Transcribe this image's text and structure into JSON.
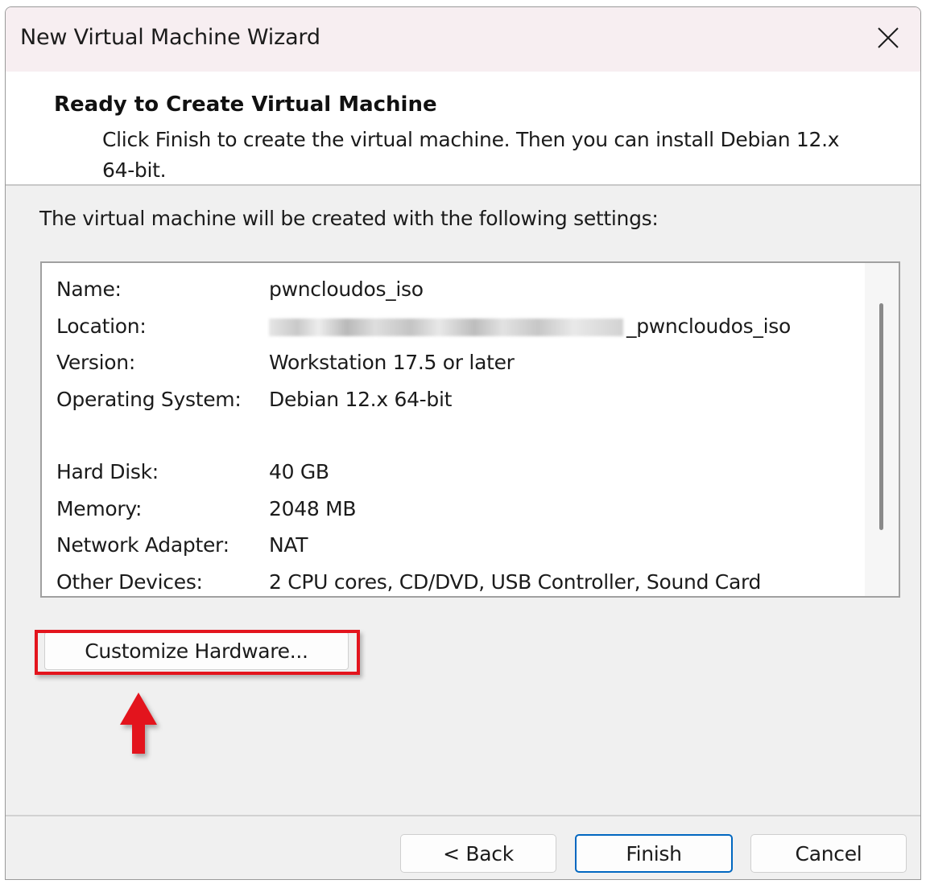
{
  "window": {
    "title": "New Virtual Machine Wizard",
    "close_icon": "close-icon"
  },
  "header": {
    "title": "Ready to Create Virtual Machine",
    "description": "Click Finish to create the virtual machine. Then you can install Debian 12.x 64-bit."
  },
  "intro": "The virtual machine will be created with the following settings:",
  "settings": {
    "name": {
      "label": "Name:",
      "value": "pwncloudos_iso"
    },
    "location": {
      "label": "Location:",
      "value_suffix": "_pwncloudos_iso"
    },
    "version": {
      "label": "Version:",
      "value": "Workstation 17.5 or later"
    },
    "os": {
      "label": "Operating System:",
      "value": "Debian 12.x 64-bit"
    },
    "hard_disk": {
      "label": "Hard Disk:",
      "value": "40 GB"
    },
    "memory": {
      "label": "Memory:",
      "value": "2048 MB"
    },
    "network": {
      "label": "Network Adapter:",
      "value": "NAT"
    },
    "other": {
      "label": "Other Devices:",
      "value": "2 CPU cores, CD/DVD, USB Controller, Sound Card"
    }
  },
  "buttons": {
    "customize": "Customize Hardware...",
    "back": "< Back",
    "finish": "Finish",
    "cancel": "Cancel"
  },
  "colors": {
    "highlight": "#e3141d",
    "accent": "#0067c0"
  }
}
